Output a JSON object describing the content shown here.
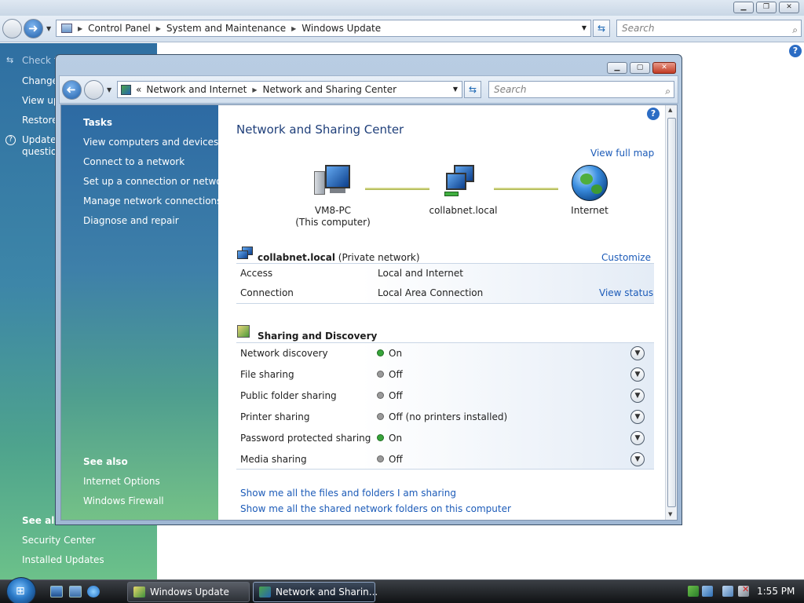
{
  "bg_window": {
    "breadcrumb": [
      "Control Panel",
      "System and Maintenance",
      "Windows Update"
    ],
    "search_placeholder": "Search",
    "left_links": [
      "Check f",
      "Change",
      "View up",
      "Restore",
      "Update",
      "questio"
    ],
    "see_also_heading": "See als",
    "see_also_links": [
      "Security Center",
      "Installed Updates"
    ]
  },
  "fg_window": {
    "breadcrumb_prefix": "«",
    "breadcrumb": [
      "Network and Internet",
      "Network and Sharing Center"
    ],
    "search_placeholder": "Search",
    "tasks": {
      "heading": "Tasks",
      "links": [
        "View computers and devices",
        "Connect to a network",
        "Set up a connection or network",
        "Manage network connections",
        "Diagnose and repair"
      ],
      "see_also_heading": "See also",
      "see_also_links": [
        "Internet Options",
        "Windows Firewall"
      ]
    },
    "title": "Network and Sharing Center",
    "view_full_map": "View full map",
    "map": {
      "computer_name": "VM8-PC",
      "computer_sub": "(This computer)",
      "network_name": "collabnet.local",
      "internet": "Internet"
    },
    "network": {
      "name": "collabnet.local",
      "type": "(Private network)",
      "customize": "Customize",
      "rows": [
        {
          "label": "Access",
          "value": "Local and Internet",
          "action": ""
        },
        {
          "label": "Connection",
          "value": "Local Area Connection",
          "action": "View status"
        }
      ]
    },
    "sharing": {
      "heading": "Sharing and Discovery",
      "rows": [
        {
          "label": "Network discovery",
          "status": "On",
          "state": "on"
        },
        {
          "label": "File sharing",
          "status": "Off",
          "state": "off"
        },
        {
          "label": "Public folder sharing",
          "status": "Off",
          "state": "off"
        },
        {
          "label": "Printer sharing",
          "status": "Off (no printers installed)",
          "state": "off"
        },
        {
          "label": "Password protected sharing",
          "status": "On",
          "state": "on"
        },
        {
          "label": "Media sharing",
          "status": "Off",
          "state": "off"
        }
      ]
    },
    "bottom_links": [
      "Show me all the files and folders I am sharing",
      "Show me all the shared network folders on this computer"
    ]
  },
  "taskbar": {
    "buttons": [
      "Windows Update",
      "Network and Sharin..."
    ],
    "clock": "1:55 PM"
  },
  "colors": {
    "link_blue": "#1c5bb8",
    "title_blue": "#1f3f7a",
    "status_on": "#37a43a",
    "status_off": "#9a9a9a"
  }
}
